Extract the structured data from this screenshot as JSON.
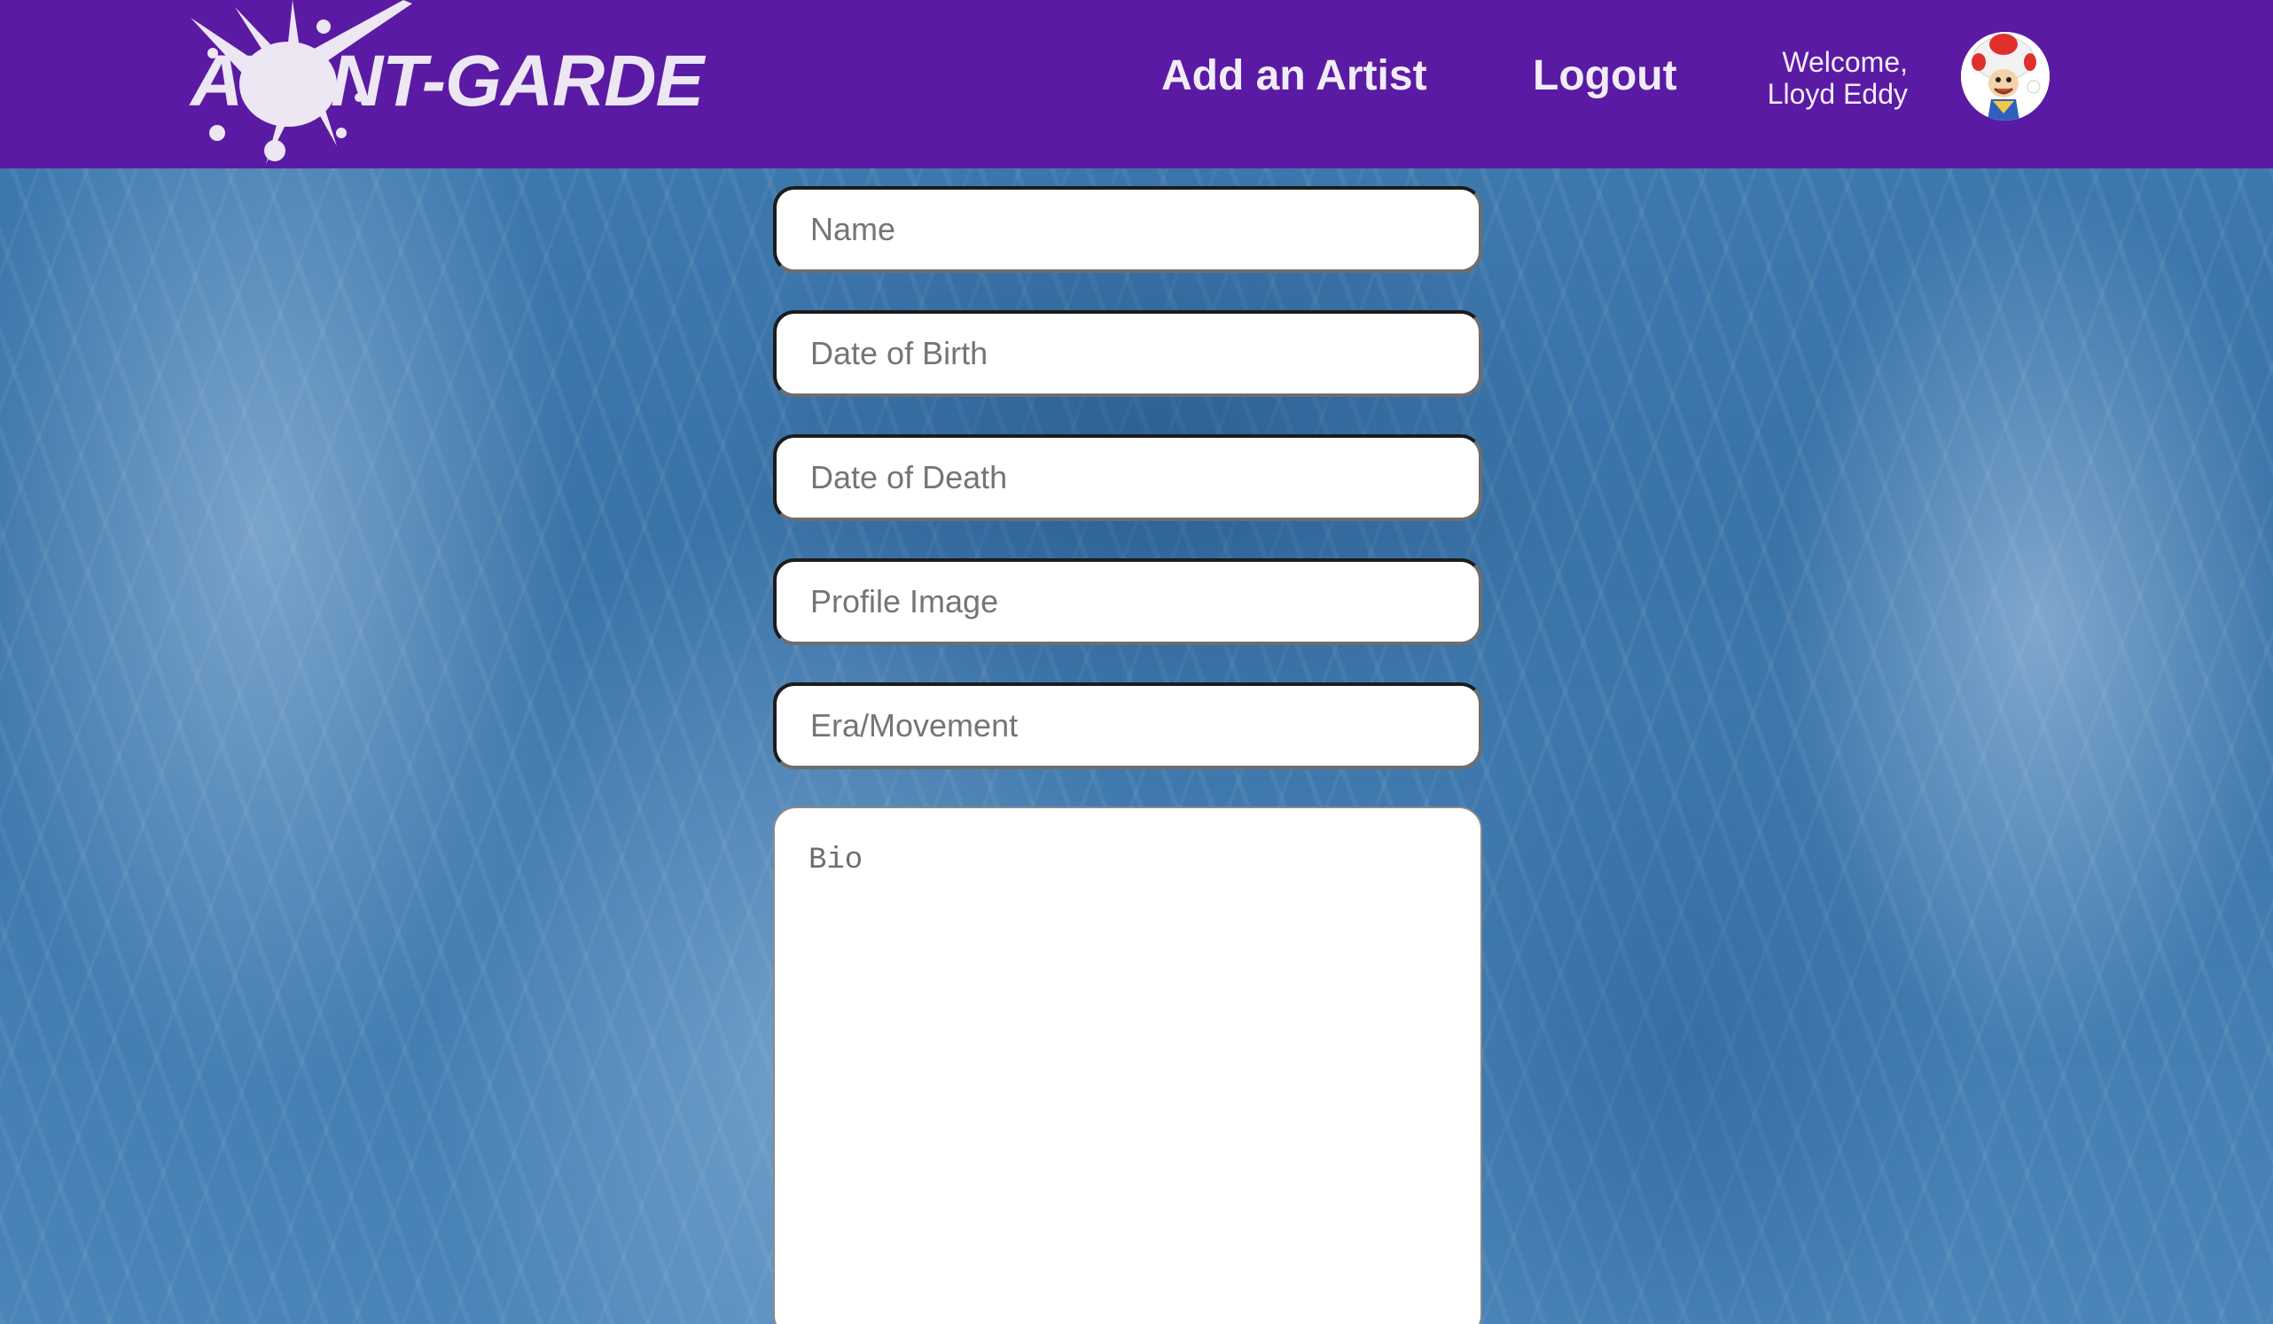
{
  "header": {
    "logo_text": "AVANT-GARDE",
    "nav": {
      "add_artist": "Add an Artist",
      "logout": "Logout"
    },
    "welcome": {
      "line1": "Welcome,",
      "line2": "Lloyd Eddy"
    },
    "avatar_icon": "mushroom-character-avatar"
  },
  "form": {
    "name_placeholder": "Name",
    "dob_placeholder": "Date of Birth",
    "dod_placeholder": "Date of Death",
    "profile_image_placeholder": "Profile Image",
    "era_placeholder": "Era/Movement",
    "bio_placeholder": "Bio"
  },
  "colors": {
    "header_bg": "#5b1aa3",
    "header_text": "#f1ecf7",
    "background": "#3a74a9"
  }
}
